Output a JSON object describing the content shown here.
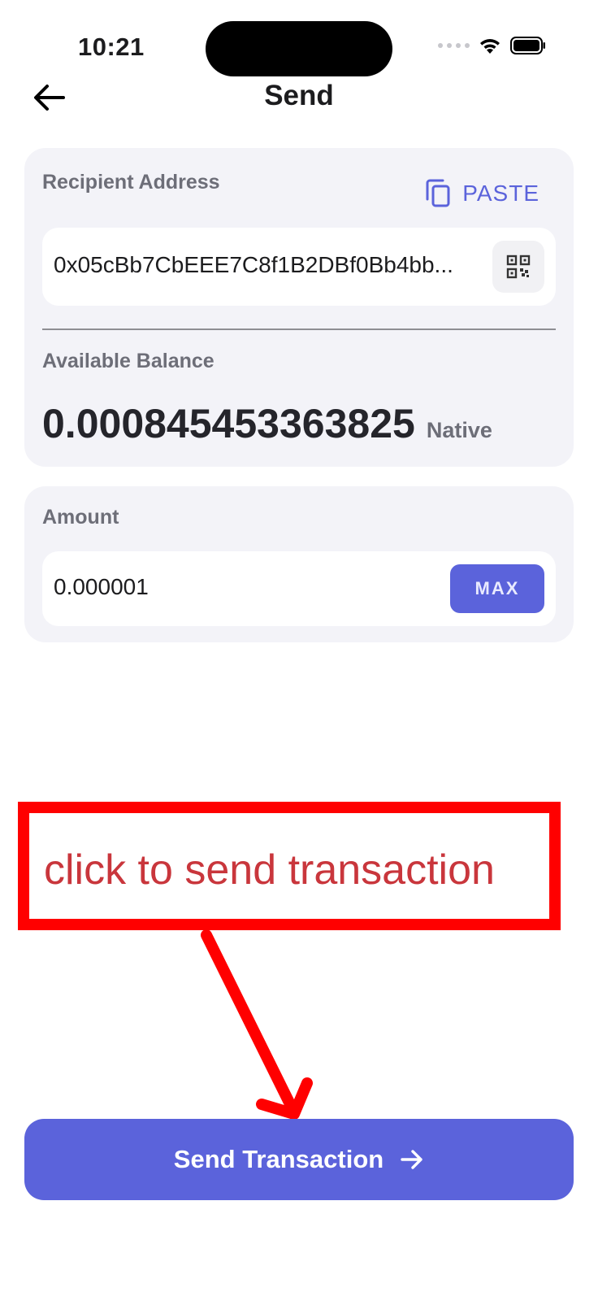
{
  "status_bar": {
    "time": "10:21"
  },
  "header": {
    "title": "Send",
    "back_icon": "arrow-left-icon"
  },
  "recipient": {
    "label": "Recipient Address",
    "paste_label": "PASTE",
    "paste_icon": "copy-icon",
    "address": "0x05cBb7CbEEE7C8f1B2DBf0Bb4bb...",
    "scan_icon": "qr-scan-icon"
  },
  "balance": {
    "label": "Available Balance",
    "value": "0.000845453363825",
    "unit": "Native"
  },
  "amount": {
    "label": "Amount",
    "value": "0.000001",
    "max_label": "MAX"
  },
  "annotation": {
    "text": "click to send transaction",
    "color": "#ff0000"
  },
  "send_button": {
    "label": "Send Transaction",
    "icon": "arrow-right-icon"
  },
  "colors": {
    "accent": "#5b63db",
    "card_bg": "#f3f3f8"
  }
}
